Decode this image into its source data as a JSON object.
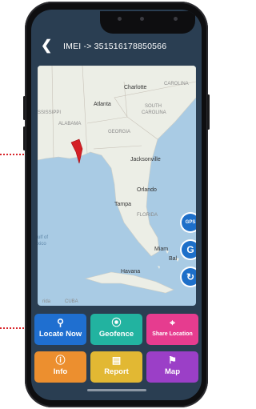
{
  "header": {
    "back_icon": "chevron-left-icon",
    "imei_text": "IMEI -> 351516178850566"
  },
  "map": {
    "labels": {
      "charlotte": "Charlotte",
      "carolina_ne": "CAROLINA",
      "atlanta": "Atlanta",
      "south_carolina_1": "SOUTH",
      "south_carolina_2": "CAROLINA",
      "mississippi": "SSISSIPPI",
      "alabama": "ALABAMA",
      "georgia": "GEORGIA",
      "jacksonville": "Jacksonville",
      "orlando": "Orlando",
      "tampa": "Tampa",
      "florida": "FLORIDA",
      "gulf_1": "ulf of",
      "gulf_2": "xico",
      "miami": "Miam",
      "havana": "Havana",
      "cuba": "CUBA",
      "bal": "Bal",
      "merida": "rida"
    },
    "buttons": {
      "gps": "GPS",
      "g": "G"
    }
  },
  "actions": [
    {
      "label": "Locate Now",
      "icon": "locate-pin-icon",
      "color": "#1f6fd0"
    },
    {
      "label": "Geofence",
      "icon": "geofence-icon",
      "color": "#22b3a0"
    },
    {
      "label": "Share Location",
      "icon": "share-location-icon",
      "color": "#e63c8f"
    },
    {
      "label": "Info",
      "icon": "info-icon",
      "color": "#ec8f2f"
    },
    {
      "label": "Report",
      "icon": "report-icon",
      "color": "#e2b833"
    },
    {
      "label": "Map",
      "icon": "map-icon",
      "color": "#9b3fc7"
    }
  ]
}
